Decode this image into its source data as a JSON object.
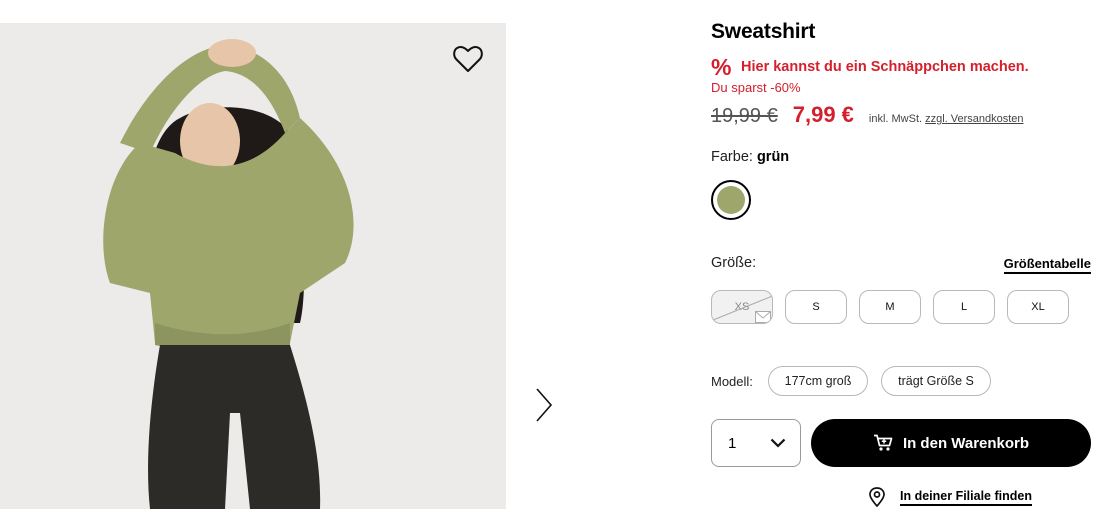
{
  "product": {
    "title": "Sweatshirt",
    "deal_icon": "percent-icon",
    "deal_text": "Hier kannst du ein Schnäppchen machen.",
    "savings_text": "Du sparst -60%",
    "old_price": "19,99 €",
    "new_price": "7,99 €",
    "tax_note": "inkl. MwSt.",
    "shipping_link": "zzgl. Versandkosten",
    "colors": {
      "sale": "#d41f2c",
      "swatch": "#9ea66c"
    }
  },
  "color": {
    "label": "Farbe:",
    "selected": "grün"
  },
  "size": {
    "label": "Größe:",
    "table_link": "Größentabelle",
    "options": [
      {
        "label": "XS",
        "available": false
      },
      {
        "label": "S",
        "available": true
      },
      {
        "label": "M",
        "available": true
      },
      {
        "label": "L",
        "available": true
      },
      {
        "label": "XL",
        "available": true
      }
    ]
  },
  "model": {
    "label": "Modell:",
    "height": "177cm groß",
    "wears": "trägt Größe S"
  },
  "purchase": {
    "quantity": "1",
    "cart_button": "In den Warenkorb",
    "store_link": "In deiner Filiale finden"
  },
  "icons": [
    "heart-icon",
    "chevron-right-icon",
    "chevron-down-icon",
    "cart-icon",
    "location-pin-icon",
    "envelope-icon"
  ]
}
